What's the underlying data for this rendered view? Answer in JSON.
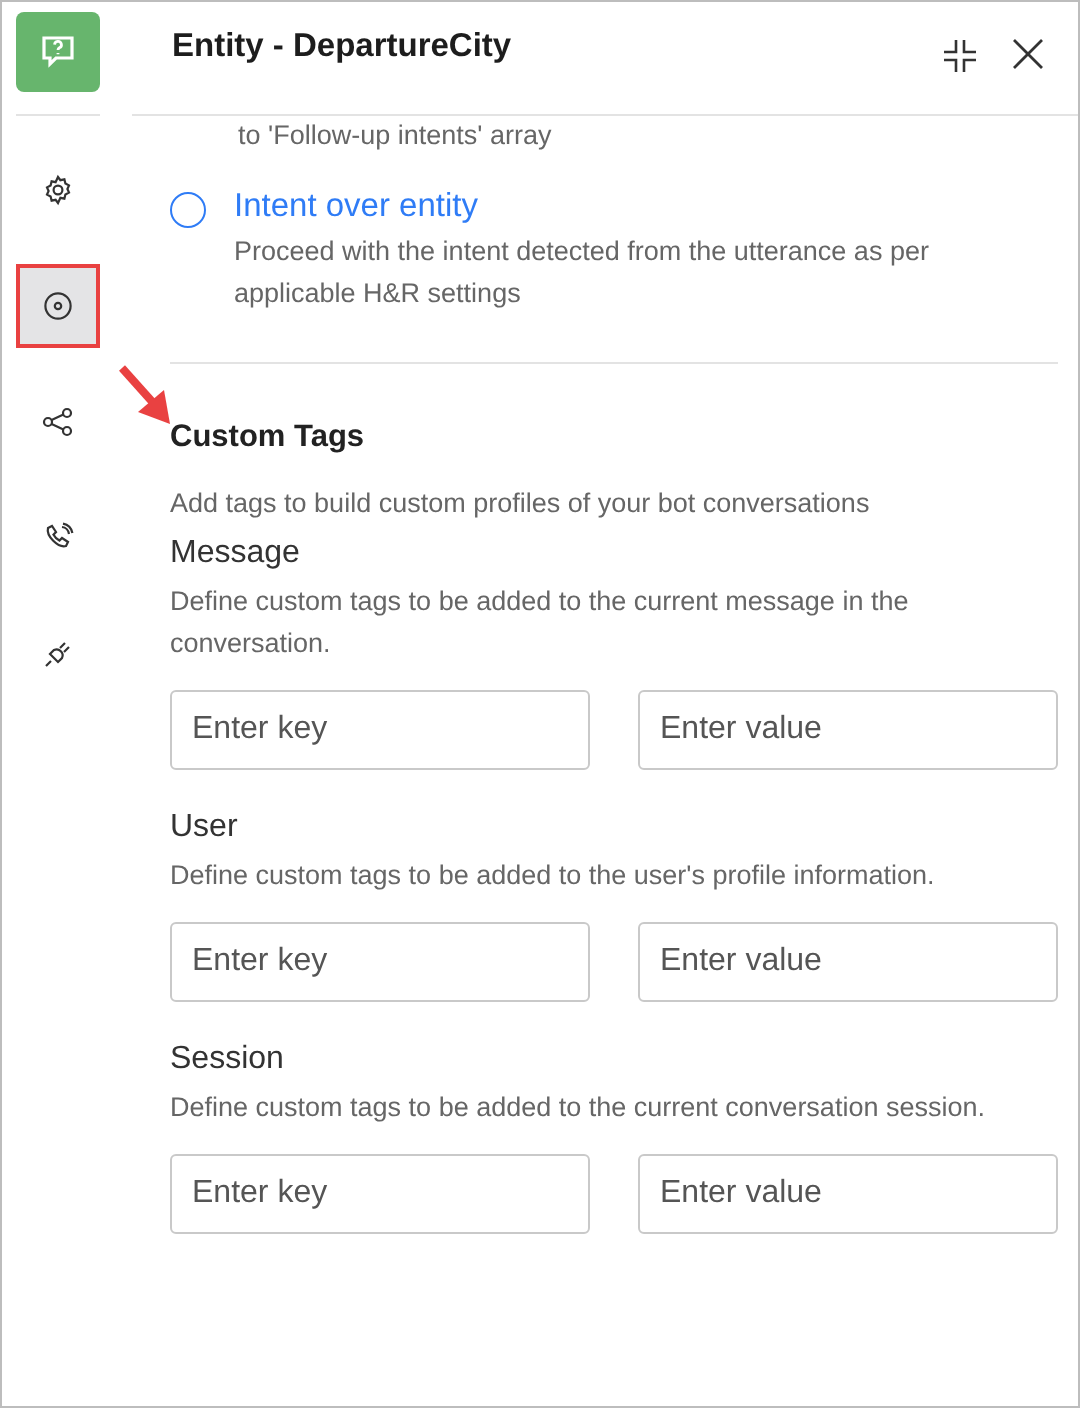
{
  "window": {
    "title": "Entity - DepartureCity"
  },
  "sidebar": {
    "items": [
      {
        "kind": "settings",
        "selected": false
      },
      {
        "kind": "target",
        "selected": true
      },
      {
        "kind": "share",
        "selected": false
      },
      {
        "kind": "phone",
        "selected": false
      },
      {
        "kind": "plug",
        "selected": false
      }
    ]
  },
  "content": {
    "cut_text": "to 'Follow-up intents' array",
    "options": [
      {
        "label": "Intent over entity",
        "description": "Proceed with the intent detected from the utterance as per applicable H&R settings",
        "selected": false
      }
    ],
    "section_title": "Custom Tags",
    "section_description": "Add tags to build custom profiles of your bot conversations",
    "groups": [
      {
        "title": "Message",
        "description": "Define custom tags to be added to the current message in the conversation.",
        "key_placeholder": "Enter key",
        "value_placeholder": "Enter value"
      },
      {
        "title": "User",
        "description": "Define custom tags to be added to the user's profile information.",
        "key_placeholder": "Enter key",
        "value_placeholder": "Enter value"
      },
      {
        "title": "Session",
        "description": "Define custom tags to be added to the current conversation session.",
        "key_placeholder": "Enter key",
        "value_placeholder": "Enter value"
      }
    ]
  }
}
